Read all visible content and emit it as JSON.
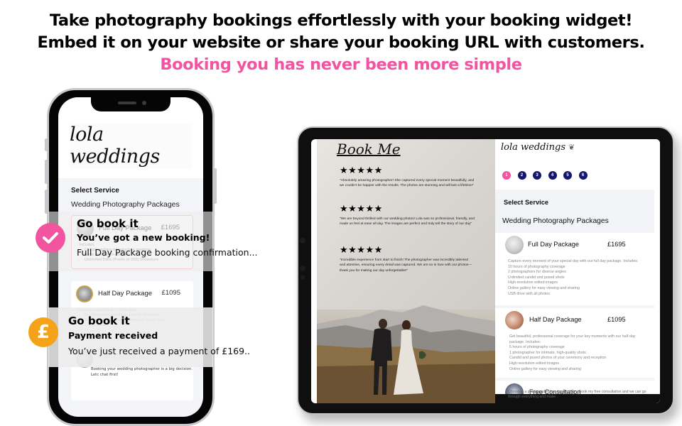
{
  "headline": {
    "line1": "Take photography bookings effortlessly with your booking widget!",
    "line2": "Embed it on your website or share your booking URL with customers.",
    "line3": "Booking you has never been more simple"
  },
  "colors": {
    "accent_pink": "#f2549f",
    "accent_orange": "#f5a21b",
    "step_navy": "#14176e",
    "panel_bg": "#f3f4f8"
  },
  "phone": {
    "logo": "lola weddings",
    "select_service": "Select Service",
    "packages_heading": "Wedding Photography Packages",
    "cards": [
      {
        "name": "Full Day Package",
        "price": "£1695",
        "desc_title": "Includes:",
        "desc_items": [
          "Complimentary introductory meeting",
          "Bride and groom portraits",
          "Unlimited Edits (Proofs of 250) Showstore"
        ]
      },
      {
        "name": "Half Day Package",
        "price": "£1095",
        "desc_title": "Includes everything in silver plus:",
        "desc_items": [
          "Two 'in-person' meetings (within 30 miles)",
          "One 'mini-shoot' (band ceremony, hand-tying,",
          "... and more"
        ]
      },
      {
        "name": "Free Consultation",
        "price": "",
        "desc_text": "Booking your wedding photographer is a big decision. Letc chat first!"
      }
    ]
  },
  "notifications": [
    {
      "icon": "check-icon",
      "app": "Go book it",
      "title": "You’ve got a new booking!",
      "body": "Full Day Package booking confirmation..."
    },
    {
      "icon": "pound-icon",
      "icon_glyph": "£",
      "app": "Go book it",
      "title": "Payment received",
      "body": "You’ve just received a payment of £169.."
    }
  ],
  "tablet": {
    "left": {
      "title": "Book Me",
      "reviews": [
        {
          "stars": "★★★★★",
          "rating": 5,
          "quote": "\"Absolutely amazing photographer! She captured every special moment beautifully, and we couldn't be happier with the results. The photos are stunning and will last a lifetime!\""
        },
        {
          "stars": "★★★★★",
          "rating": 5,
          "quote": "\"We are beyond thrilled with our wedding photos! Lola was so professional, friendly, and made us feel at ease all day. The images are perfect and truly tell the story of our day\""
        },
        {
          "stars": "★★★★★",
          "rating": 5,
          "quote": "\"Incredible experience from start to finish! The photographer was incredibly talented and attentive, ensuring every detail was captured. We are so in love with our photos—thank you for making our day unforgettable!\""
        }
      ]
    },
    "right": {
      "logo": "lola weddings",
      "logo_decoration": "❦",
      "steps": [
        "1",
        "2",
        "3",
        "4",
        "5",
        "6"
      ],
      "active_step": 1,
      "select_service": "Select Service",
      "packages_heading": "Wedding Photography Packages",
      "cards": [
        {
          "name": "Full Day Package",
          "price": "£1695",
          "desc": [
            "Capture every moment of your special day with our full day package. Includes:",
            "10 hours of photography coverage",
            "2 photographers for diverse angles",
            "Unlimited candid and posed shots",
            "High-resolution edited images",
            "Online gallery for easy viewing and sharing",
            "USB drive with all photos"
          ]
        },
        {
          "name": "Half Day Package",
          "price": "£1095",
          "desc": [
            "Get beautiful, professional coverage for your key moments with our half-day package. Includes:",
            "5 hours of photography coverage",
            "1 photographer for intimate, high-quality shots",
            "Candid and posed photos of your ceremony and reception",
            "High-resolution edited images",
            "Online gallery for easy viewing and sharing"
          ]
        },
        {
          "name": "Free Consultation",
          "price": "",
          "desc": [
            "Choosing a photographer is a big decision. Book my free consultation and we can go through everything and make ."
          ]
        }
      ]
    }
  }
}
